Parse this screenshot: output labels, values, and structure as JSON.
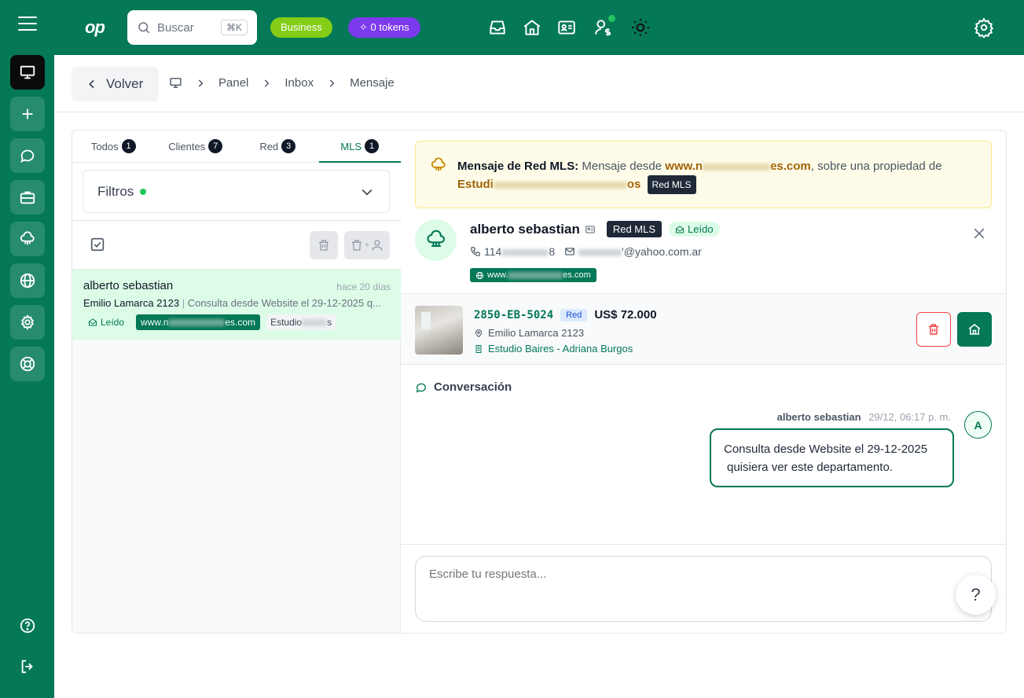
{
  "topbar": {
    "logo": "op",
    "search_placeholder": "Buscar",
    "search_shortcut": "⌘K",
    "plan_badge": "Business",
    "tokens_badge": "0 tokens"
  },
  "breadcrumb": {
    "back_label": "Volver",
    "items": [
      "Panel",
      "Inbox",
      "Mensaje"
    ]
  },
  "tabs": [
    {
      "label": "Todos",
      "count": "1"
    },
    {
      "label": "Clientes",
      "count": "7"
    },
    {
      "label": "Red",
      "count": "3"
    },
    {
      "label": "MLS",
      "count": "1"
    }
  ],
  "active_tab": "MLS",
  "filters": {
    "label": "Filtros"
  },
  "message_list": [
    {
      "name": "alberto sebastian",
      "time": "hace 20 días",
      "address": "Emilio Lamarca 2123",
      "preview": "Consulta desde Website el 29-12-2025 q...",
      "status": "Leído",
      "website_start": "www.n",
      "website_end": "es.com",
      "agency_start": "Estudio",
      "agency_end": "s"
    }
  ],
  "notice": {
    "title": "Mensaje de Red MLS:",
    "text1": "Mensaje desde",
    "domain_start": "www.n",
    "domain_end": "es.com",
    "text2": ", sobre una propiedad de",
    "agency_start": "Estudi",
    "agency_end": "os",
    "tooltip": "Red MLS"
  },
  "contact": {
    "name": "alberto sebastian",
    "network_badge": "Red MLS",
    "status": "Leído",
    "phone_start": "114",
    "phone_end": "8",
    "email_end": "'@yahoo.com.ar",
    "website_start": "www.",
    "website_end": "es.com"
  },
  "property": {
    "code": "2850-EB-5024",
    "tag": "Red",
    "price": "US$ 72.000",
    "address": "Emilio Lamarca 2123",
    "agency": "Estudio Baires - Adriana Burgos"
  },
  "conversation": {
    "title": "Conversación",
    "messages": [
      {
        "author": "alberto sebastian",
        "timestamp": "29/12, 06:17 p. m.",
        "line1": "Consulta desde Website el 29-12-2025",
        "line2": "quisiera ver este departamento.",
        "avatar_initial": "A"
      }
    ]
  },
  "reply": {
    "placeholder": "Escribe tu respuesta..."
  },
  "help": {
    "label": "?"
  },
  "colors": {
    "brand": "#047857",
    "business": "#84cc16",
    "tokens": "#7c3aed",
    "danger": "#ef4444"
  },
  "icons": {
    "sidebar": [
      "monitor-icon",
      "plus-icon",
      "chat-icon",
      "briefcase-icon",
      "cloud-network-icon",
      "globe-icon",
      "gear-icon",
      "lifebuoy-icon",
      "help-circle-icon",
      "logout-icon"
    ],
    "topbar": [
      "inbox-icon",
      "home-icon",
      "contact-card-icon",
      "user-dollar-icon",
      "sun-icon",
      "gear-icon"
    ]
  }
}
